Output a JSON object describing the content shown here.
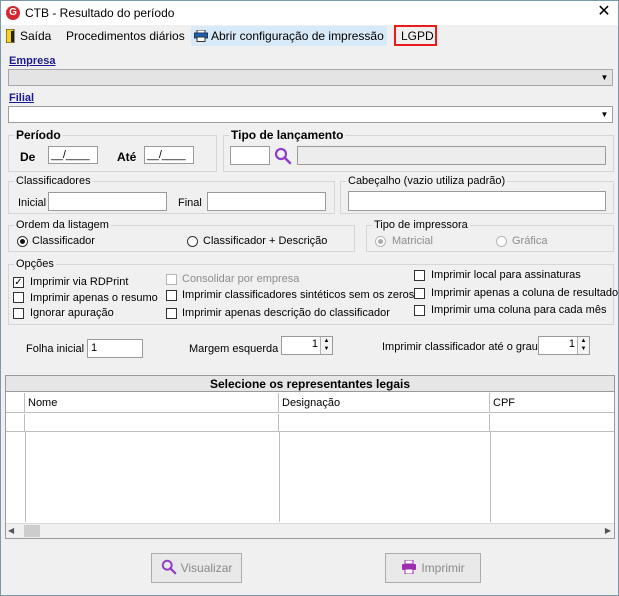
{
  "window": {
    "title": "CTB - Resultado do período",
    "close_glyph": "✕"
  },
  "menu": {
    "exit": "Saída",
    "daily": "Procedimentos diários",
    "print_config": "Abrir configuração de impressão",
    "lgpd": "LGPD"
  },
  "empresa": {
    "label": "Empresa",
    "value": ""
  },
  "filial": {
    "label": "Filial",
    "value": ""
  },
  "periodo": {
    "legend": "Período",
    "from_label": "De",
    "from_value": "__/____",
    "to_label": "Até",
    "to_value": "__/____"
  },
  "tipo_lancamento": {
    "legend": "Tipo de lançamento",
    "code": "",
    "desc": ""
  },
  "classificadores": {
    "legend": "Classificadores",
    "initial_label": "Inicial",
    "initial_value": "",
    "final_label": "Final",
    "final_value": ""
  },
  "cabecalho": {
    "legend": "Cabeçalho (vazio utiliza padrão)",
    "value": ""
  },
  "ordem": {
    "legend": "Ordem da listagem",
    "options": [
      "Classificador",
      "Classificador + Descrição"
    ],
    "selected": "Classificador"
  },
  "tipo_impressora": {
    "legend": "Tipo de impressora",
    "options": [
      "Matricial",
      "Gráfica"
    ],
    "selected": "Matricial"
  },
  "opcoes": {
    "legend": "Opções",
    "col1": [
      "Imprimir via RDPrint",
      "Imprimir apenas o resumo",
      "Ignorar apuração"
    ],
    "col2": [
      "Consolidar por empresa",
      "Imprimir classificadores sintéticos sem os zeros",
      "Imprimir apenas descrição do classificador"
    ],
    "col3": [
      "Imprimir local para assinaturas",
      "Imprimir apenas a coluna de resultado",
      "Imprimir uma coluna para cada mês"
    ],
    "checked": [
      "Imprimir via RDPrint"
    ],
    "check_glyph": "✓"
  },
  "folha_inicial": {
    "label": "Folha inicial",
    "value": "1"
  },
  "margem": {
    "label": "Margem esquerda",
    "value": "1"
  },
  "grau": {
    "label": "Imprimir classificador até o grau",
    "value": "1"
  },
  "representantes": {
    "title": "Selecione os representantes legais",
    "columns": [
      "Nome",
      "Designação",
      "CPF"
    ]
  },
  "buttons": {
    "visualizar": "Visualizar",
    "imprimir": "Imprimir"
  },
  "colors": {
    "accent_red": "#e81c1c",
    "label_blue": "#1b1b8f",
    "brand_red": "#d6262f",
    "search_purple": "#8f3fc4",
    "print_purple": "#9b2fb0"
  }
}
